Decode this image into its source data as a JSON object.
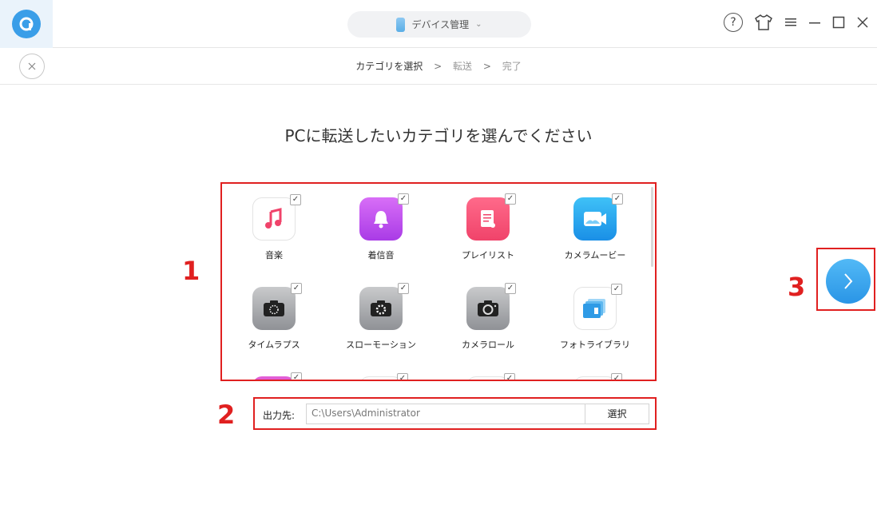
{
  "titlebar": {
    "device_label": "デバイス管理",
    "icons": [
      "app-logo-icon",
      "phone-icon",
      "chevron-down-icon",
      "help-icon",
      "skin-icon",
      "menu-icon",
      "minimize-icon",
      "maximize-icon",
      "close-icon"
    ]
  },
  "steps": {
    "step1": "カテゴリを選択",
    "step2": "転送",
    "step3": "完了",
    "separator": ">"
  },
  "heading": "PCに転送したいカテゴリを選んでください",
  "categories": [
    {
      "label": "音楽",
      "icon": "music-icon",
      "checked": true
    },
    {
      "label": "着信音",
      "icon": "ringtone-icon",
      "checked": true
    },
    {
      "label": "プレイリスト",
      "icon": "playlist-icon",
      "checked": true
    },
    {
      "label": "カメラムービー",
      "icon": "camera-movie-icon",
      "checked": true
    },
    {
      "label": "タイムラプス",
      "icon": "timelapse-icon",
      "checked": true
    },
    {
      "label": "スローモーション",
      "icon": "slow-motion-icon",
      "checked": true
    },
    {
      "label": "カメラロール",
      "icon": "camera-roll-icon",
      "checked": true
    },
    {
      "label": "フォトライブラリ",
      "icon": "photo-library-icon",
      "checked": true
    }
  ],
  "output": {
    "label": "出力先:",
    "path": "C:\\Users\\Administrator",
    "button": "選択"
  },
  "annotations": {
    "one": "1",
    "two": "2",
    "three": "3"
  },
  "colors": {
    "accent": "#3a9ee8",
    "annotation_red": "#e02020"
  }
}
